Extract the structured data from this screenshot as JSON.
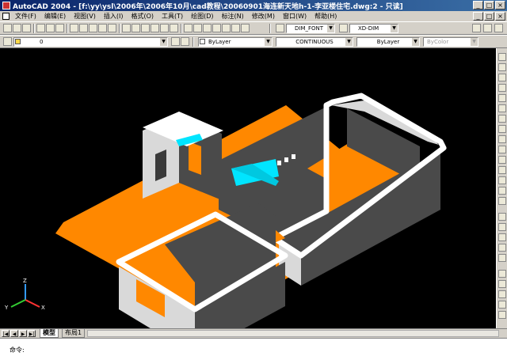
{
  "window": {
    "title": "AutoCAD 2004 - [f:\\yy\\ysl\\2006年\\2006年10月\\cad教程\\20060901海连新天地h-1-李亚楼住宅.dwg:2 - 只读]",
    "controls": [
      "_",
      "□",
      "×"
    ]
  },
  "menu": {
    "items": [
      "文件(F)",
      "编辑(E)",
      "视图(V)",
      "插入(I)",
      "格式(O)",
      "工具(T)",
      "绘图(D)",
      "标注(N)",
      "修改(M)",
      "窗口(W)",
      "帮助(H)"
    ],
    "doc_controls": [
      "_",
      "□",
      "×"
    ]
  },
  "toolbar1": {
    "text_style": "DIM_FONT",
    "dim_style": "XD-DIM"
  },
  "toolbar2": {
    "layer": "0",
    "color": "ByLayer",
    "linetype": "CONTINUOUS",
    "lineweight": "ByLayer",
    "plot_style": "ByColor"
  },
  "ucs": {
    "x_label": "X",
    "y_label": "Y",
    "z_label": "Z"
  },
  "tabs": {
    "model": "模型",
    "layout1": "布局1"
  },
  "command": {
    "prompt": "命令:"
  },
  "colors": {
    "floor": "#ff8800",
    "wall_top": "#ffffff",
    "wall_light": "#d9d9d9",
    "wall_dark": "#4a4a4a",
    "beam": "#00e5ff",
    "background": "#000000"
  }
}
